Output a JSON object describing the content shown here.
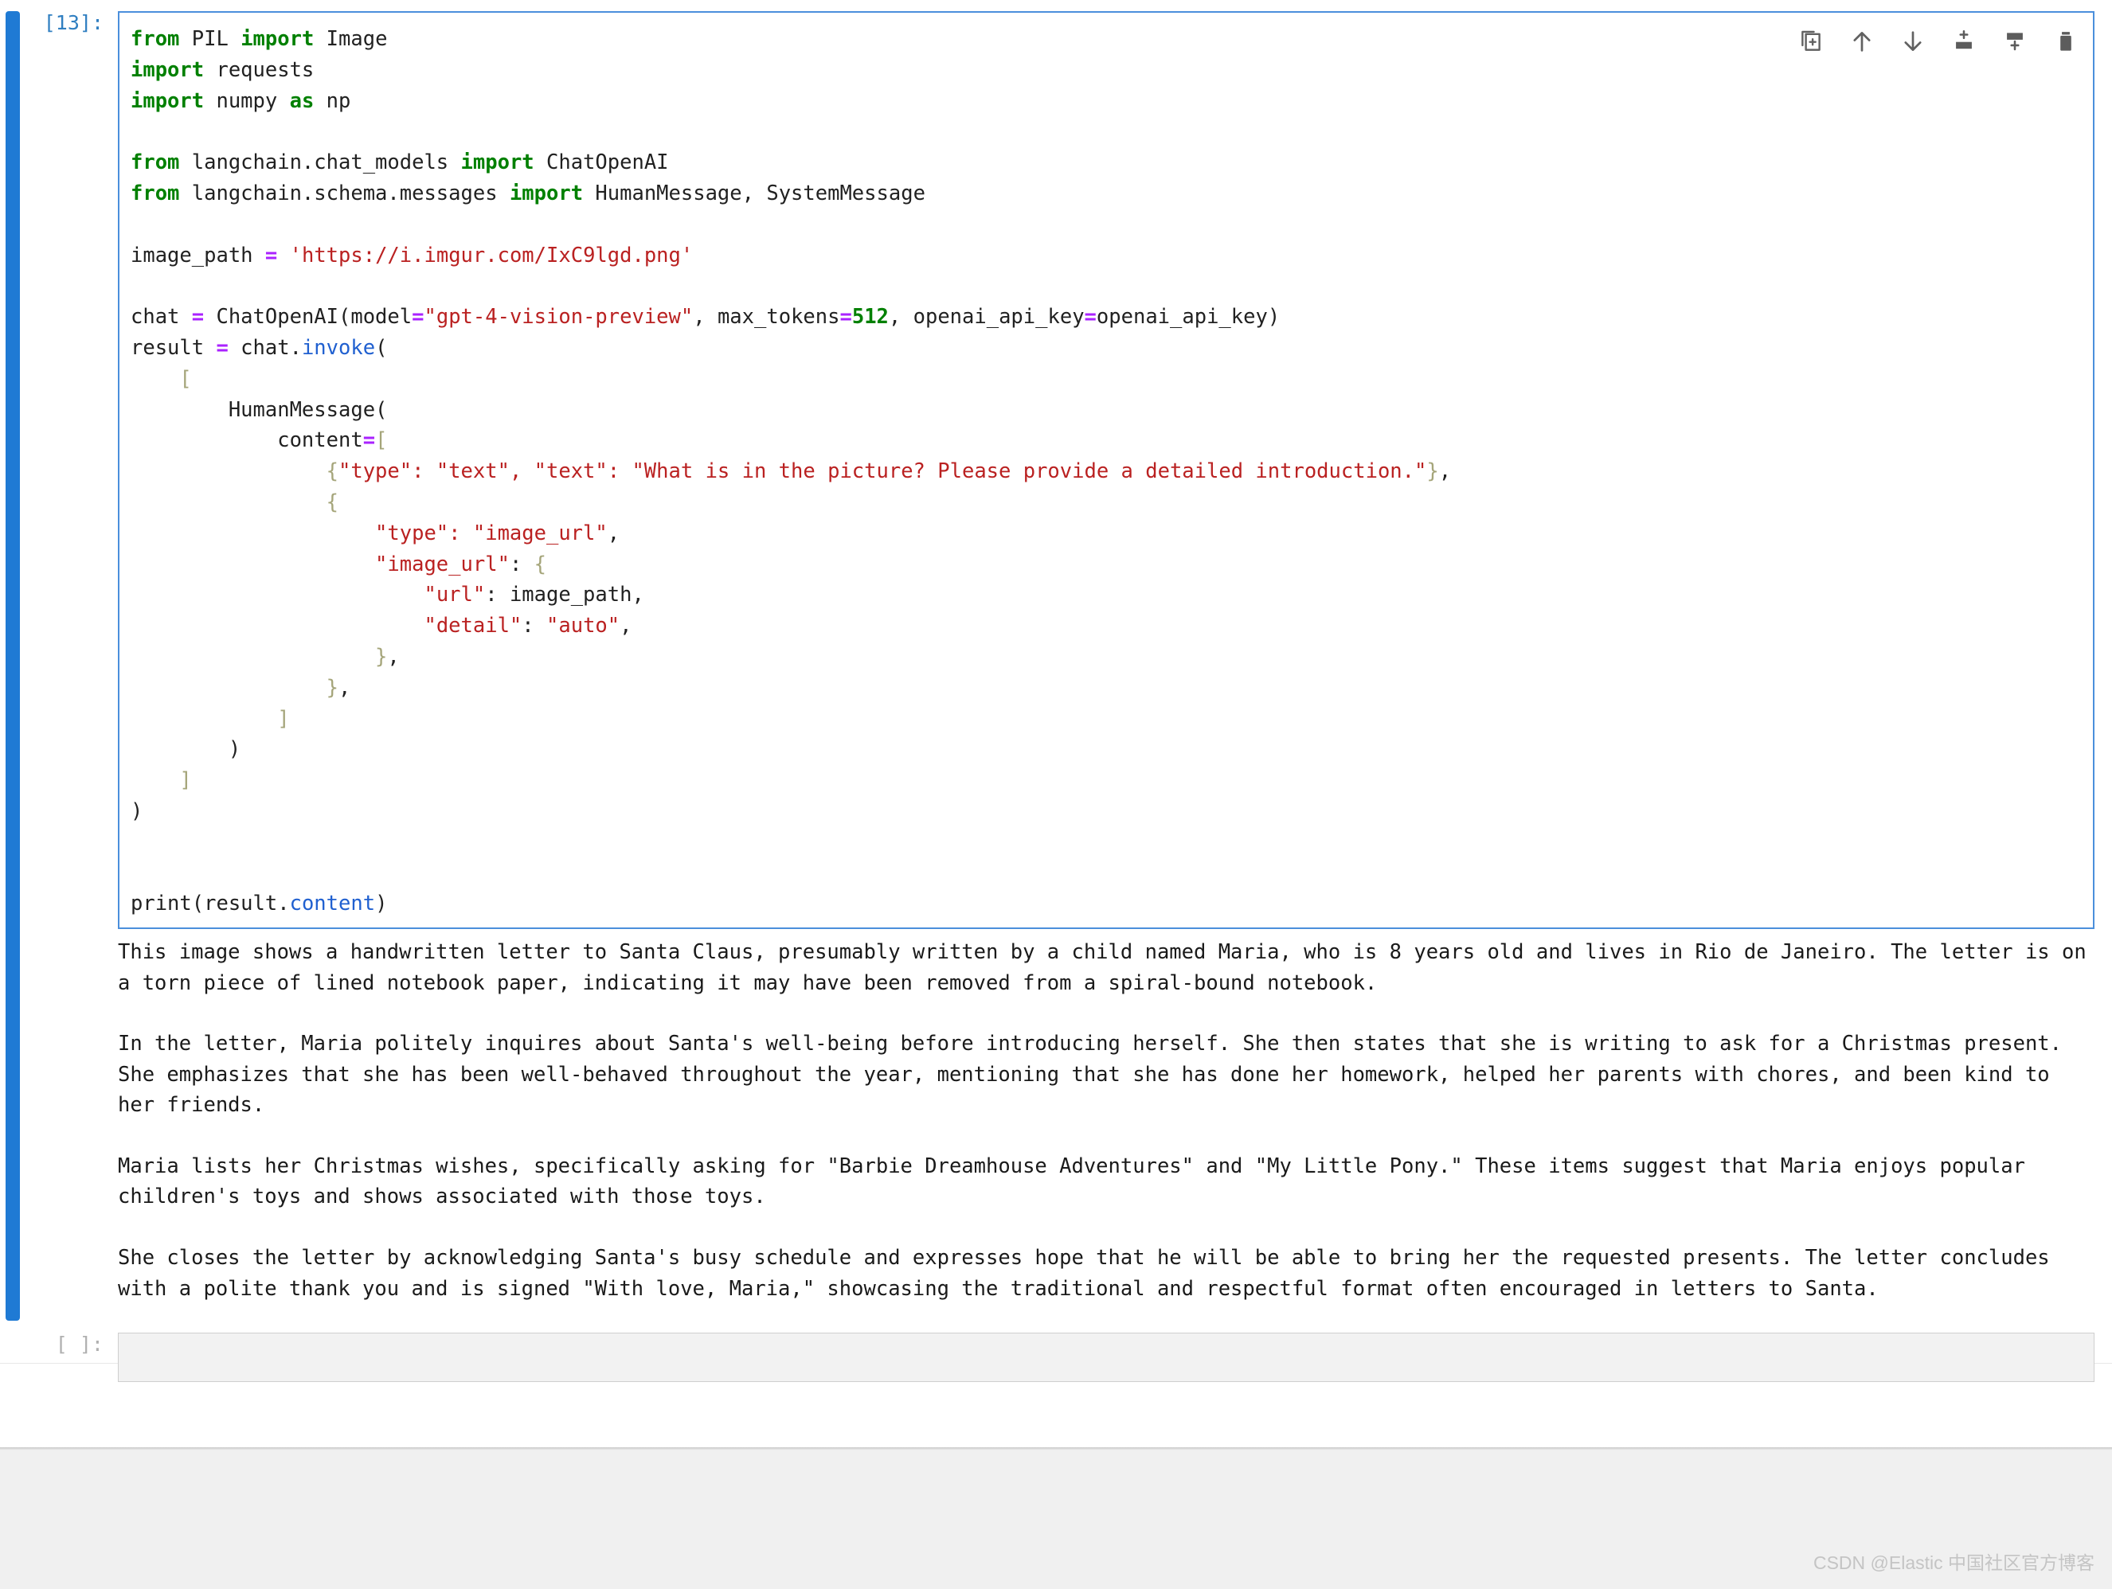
{
  "notebook": {
    "code_cell": {
      "prompt": "[13]:",
      "execution_count": 13,
      "language": "python",
      "source_lines": [
        [
          {
            "t": "from ",
            "c": "k"
          },
          {
            "t": "PIL ",
            "c": "pl"
          },
          {
            "t": "import ",
            "c": "k"
          },
          {
            "t": "Image",
            "c": "pl"
          }
        ],
        [
          {
            "t": "import ",
            "c": "k"
          },
          {
            "t": "requests",
            "c": "pl"
          }
        ],
        [
          {
            "t": "import ",
            "c": "k"
          },
          {
            "t": "numpy ",
            "c": "pl"
          },
          {
            "t": "as ",
            "c": "k"
          },
          {
            "t": "np",
            "c": "pl"
          }
        ],
        [],
        [
          {
            "t": "from ",
            "c": "k"
          },
          {
            "t": "langchain.chat_models ",
            "c": "pl"
          },
          {
            "t": "import ",
            "c": "k"
          },
          {
            "t": "ChatOpenAI",
            "c": "pl"
          }
        ],
        [
          {
            "t": "from ",
            "c": "k"
          },
          {
            "t": "langchain.schema.messages ",
            "c": "pl"
          },
          {
            "t": "import ",
            "c": "k"
          },
          {
            "t": "HumanMessage, SystemMessage",
            "c": "pl"
          }
        ],
        [],
        [
          {
            "t": "image_path ",
            "c": "pl"
          },
          {
            "t": "=",
            "c": "op"
          },
          {
            "t": " ",
            "c": "pl"
          },
          {
            "t": "'https://i.imgur.com/IxC9lgd.png'",
            "c": "s"
          }
        ],
        [],
        [
          {
            "t": "chat ",
            "c": "pl"
          },
          {
            "t": "=",
            "c": "op"
          },
          {
            "t": " ChatOpenAI(model",
            "c": "pl"
          },
          {
            "t": "=",
            "c": "op"
          },
          {
            "t": "\"gpt-4-vision-preview\"",
            "c": "s"
          },
          {
            "t": ", max_tokens",
            "c": "pl"
          },
          {
            "t": "=",
            "c": "op"
          },
          {
            "t": "512",
            "c": "n"
          },
          {
            "t": ", openai_api_key",
            "c": "pl"
          },
          {
            "t": "=",
            "c": "op"
          },
          {
            "t": "openai_api_key)",
            "c": "pl"
          }
        ],
        [
          {
            "t": "result ",
            "c": "pl"
          },
          {
            "t": "=",
            "c": "op"
          },
          {
            "t": " chat.",
            "c": "pl"
          },
          {
            "t": "invoke",
            "c": "f"
          },
          {
            "t": "(",
            "c": "pl"
          }
        ],
        [
          {
            "t": "    ",
            "c": "pl"
          },
          {
            "t": "[",
            "c": "br"
          }
        ],
        [
          {
            "t": "        HumanMessage(",
            "c": "pl"
          }
        ],
        [
          {
            "t": "            content",
            "c": "pl"
          },
          {
            "t": "=",
            "c": "op"
          },
          {
            "t": "[",
            "c": "br"
          }
        ],
        [
          {
            "t": "                ",
            "c": "pl"
          },
          {
            "t": "{",
            "c": "br"
          },
          {
            "t": "\"type\": \"text\", \"text\": \"What is in the picture? Please provide a detailed introduction.\"",
            "c": "s"
          },
          {
            "t": "}",
            "c": "br"
          },
          {
            "t": ",",
            "c": "pl"
          }
        ],
        [
          {
            "t": "                ",
            "c": "pl"
          },
          {
            "t": "{",
            "c": "br"
          }
        ],
        [
          {
            "t": "                    ",
            "c": "pl"
          },
          {
            "t": "\"type\": \"image_url\"",
            "c": "s"
          },
          {
            "t": ",",
            "c": "pl"
          }
        ],
        [
          {
            "t": "                    ",
            "c": "pl"
          },
          {
            "t": "\"image_url\"",
            "c": "s"
          },
          {
            "t": ": ",
            "c": "pl"
          },
          {
            "t": "{",
            "c": "br"
          }
        ],
        [
          {
            "t": "                        ",
            "c": "pl"
          },
          {
            "t": "\"url\"",
            "c": "s"
          },
          {
            "t": ": image_path,",
            "c": "pl"
          }
        ],
        [
          {
            "t": "                        ",
            "c": "pl"
          },
          {
            "t": "\"detail\"",
            "c": "s"
          },
          {
            "t": ": ",
            "c": "pl"
          },
          {
            "t": "\"auto\"",
            "c": "s"
          },
          {
            "t": ",",
            "c": "pl"
          }
        ],
        [
          {
            "t": "                    ",
            "c": "pl"
          },
          {
            "t": "}",
            "c": "br"
          },
          {
            "t": ",",
            "c": "pl"
          }
        ],
        [
          {
            "t": "                ",
            "c": "pl"
          },
          {
            "t": "}",
            "c": "br"
          },
          {
            "t": ",",
            "c": "pl"
          }
        ],
        [
          {
            "t": "            ",
            "c": "pl"
          },
          {
            "t": "]",
            "c": "br"
          }
        ],
        [
          {
            "t": "        )",
            "c": "pl"
          }
        ],
        [
          {
            "t": "    ",
            "c": "pl"
          },
          {
            "t": "]",
            "c": "br"
          }
        ],
        [
          {
            "t": ")",
            "c": "pl"
          }
        ],
        [],
        [],
        [
          {
            "t": "print(result.",
            "c": "pl"
          },
          {
            "t": "content",
            "c": "f"
          },
          {
            "t": ")",
            "c": "pl"
          }
        ]
      ],
      "toolbar": [
        {
          "name": "duplicate-cell-icon",
          "label": "Duplicate this cell"
        },
        {
          "name": "move-cell-up-icon",
          "label": "Move this cell up"
        },
        {
          "name": "move-cell-down-icon",
          "label": "Move this cell down"
        },
        {
          "name": "insert-cell-above-icon",
          "label": "Insert a cell above"
        },
        {
          "name": "insert-cell-below-icon",
          "label": "Insert a cell below"
        },
        {
          "name": "delete-cell-icon",
          "label": "Delete this cell"
        }
      ]
    },
    "output_cell": {
      "text": "This image shows a handwritten letter to Santa Claus, presumably written by a child named Maria, who is 8 years old and lives in Rio de Janeiro. The letter is on a torn piece of lined notebook paper, indicating it may have been removed from a spiral-bound notebook.\n\nIn the letter, Maria politely inquires about Santa's well-being before introducing herself. She then states that she is writing to ask for a Christmas present. She emphasizes that she has been well-behaved throughout the year, mentioning that she has done her homework, helped her parents with chores, and been kind to her friends.\n\nMaria lists her Christmas wishes, specifically asking for \"Barbie Dreamhouse Adventures\" and \"My Little Pony.\" These items suggest that Maria enjoys popular children's toys and shows associated with those toys.\n\nShe closes the letter by acknowledging Santa's busy schedule and expresses hope that he will be able to bring her the requested presents. The letter concludes with a polite thank you and is signed \"With love, Maria,\" showcasing the traditional and respectful format often encouraged in letters to Santa."
    },
    "empty_cell": {
      "prompt": "[ ]:",
      "value": "",
      "placeholder": ""
    }
  },
  "watermark": {
    "text": "CSDN @Elastic 中国社区官方博客"
  },
  "colors": {
    "accent": "#1f7ad4",
    "cell_border": "#4b8fdc",
    "prompt": "#307fc1",
    "keyword": "#008000",
    "string": "#ba2121",
    "number": "#008000",
    "operator": "#aa22ff",
    "function": "#2060d0",
    "bracket": "#a5a57a",
    "text": "#212121"
  }
}
